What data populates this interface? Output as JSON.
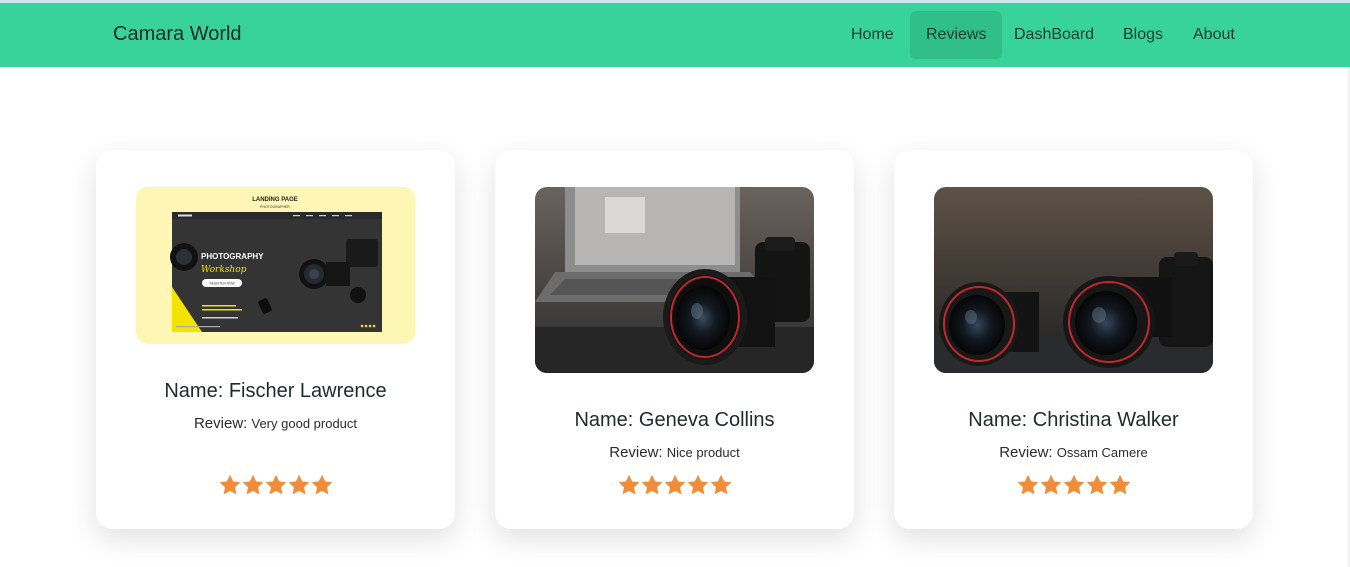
{
  "navbar": {
    "brand": "Camara World",
    "items": [
      {
        "label": "Home",
        "active": false
      },
      {
        "label": "Reviews",
        "active": true
      },
      {
        "label": "DashBoard",
        "active": false
      },
      {
        "label": "Blogs",
        "active": false
      },
      {
        "label": "About",
        "active": false
      }
    ]
  },
  "colors": {
    "navbar_bg": "#38d39a",
    "active_item_bg": "#31bf88",
    "star": "#f28c38"
  },
  "reviews": [
    {
      "name_prefix": "Name: ",
      "name": "Fischer Lawrence",
      "review_prefix": "Review: ",
      "review": "Very good product",
      "rating": 5,
      "image": "photography landing page mockup",
      "image_text": {
        "heading": "LANDING PAGE",
        "sub": "PHOTOGRAPHER",
        "title1": "PHOTOGRAPHY",
        "title2": "Workshop",
        "button": "REGISTER NOW"
      }
    },
    {
      "name_prefix": "Name: ",
      "name": "Geneva Collins",
      "review_prefix": "Review: ",
      "review": "Nice product",
      "rating": 5,
      "image": "camera lens in front of laptop"
    },
    {
      "name_prefix": "Name: ",
      "name": "Christina Walker",
      "review_prefix": "Review: ",
      "review": "Ossam Camere",
      "rating": 5,
      "image": "two camera lenses on dark table"
    }
  ]
}
